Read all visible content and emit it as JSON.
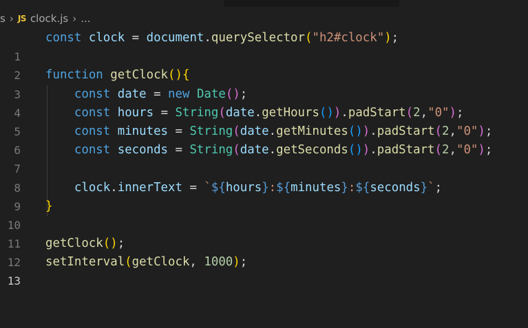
{
  "breadcrumb": {
    "parent": "s",
    "file_icon": "JS",
    "file_name": "clock.js",
    "more": "..."
  },
  "line_numbers": [
    "1",
    "2",
    "3",
    "4",
    "5",
    "6",
    "7",
    "8",
    "9",
    "10",
    "11",
    "12",
    "13"
  ],
  "active_line": "13",
  "code": {
    "l1": {
      "kw": "const",
      "var": "clock",
      "eq": " = ",
      "obj": "document",
      "dot": ".",
      "fn": "querySelector",
      "open": "(",
      "str": "\"h2#clock\"",
      "close": ")",
      "end": ";"
    },
    "l3": {
      "kw": "function",
      "fn": "getClock",
      "paren": "()",
      "brace": "{"
    },
    "l4": {
      "kw": "const",
      "var": "date",
      "eq": " = ",
      "new": "new",
      "cls": "Date",
      "paren": "()",
      "end": ";"
    },
    "l5": {
      "kw": "const",
      "var": "hours",
      "eq": " = ",
      "cls": "String",
      "o1": "(",
      "obj": "date",
      "dot": ".",
      "fn": "getHours",
      "inner": "()",
      "c1": ")",
      "dot2": ".",
      "fn2": "padStart",
      "o2": "(",
      "n": "2",
      "comma": ",",
      "str": "\"0\"",
      "c2": ")",
      "end": ";"
    },
    "l6": {
      "kw": "const",
      "var": "minutes",
      "eq": " = ",
      "cls": "String",
      "o1": "(",
      "obj": "date",
      "dot": ".",
      "fn": "getMinutes",
      "inner": "()",
      "c1": ")",
      "dot2": ".",
      "fn2": "padStart",
      "o2": "(",
      "n": "2",
      "comma": ",",
      "str": "\"0\"",
      "c2": ")",
      "end": ";"
    },
    "l7": {
      "kw": "const",
      "var": "seconds",
      "eq": " = ",
      "cls": "String",
      "o1": "(",
      "obj": "date",
      "dot": ".",
      "fn": "getSeconds",
      "inner": "()",
      "c1": ")",
      "dot2": ".",
      "fn2": "padStart",
      "o2": "(",
      "n": "2",
      "comma": ",",
      "str": "\"0\"",
      "c2": ")",
      "end": ";"
    },
    "l9": {
      "obj": "clock",
      "dot": ".",
      "prop": "innerText",
      "eq": " = ",
      "tick": "`",
      "d1": "${",
      "v1": "hours",
      "e1": "}",
      "colon1": ":",
      "d2": "${",
      "v2": "minutes",
      "e2": "}",
      "colon2": ":",
      "d3": "${",
      "v3": "seconds",
      "e3": "}",
      "tick2": "`",
      "end": ";"
    },
    "l10": {
      "brace": "}"
    },
    "l12": {
      "fn": "getClock",
      "paren": "()",
      "end": ";"
    },
    "l13": {
      "fn": "setInterval",
      "open": "(",
      "arg": "getClock",
      "comma": ", ",
      "n": "1000",
      "close": ")",
      "end": ";"
    }
  },
  "colors": {
    "background": "#1f1f1f",
    "keyword": "#4fa3e0",
    "variable": "#9cdcfe",
    "function": "#dcdcaa",
    "class": "#4ec9b0",
    "string": "#ce9178",
    "number": "#b5cea8"
  }
}
